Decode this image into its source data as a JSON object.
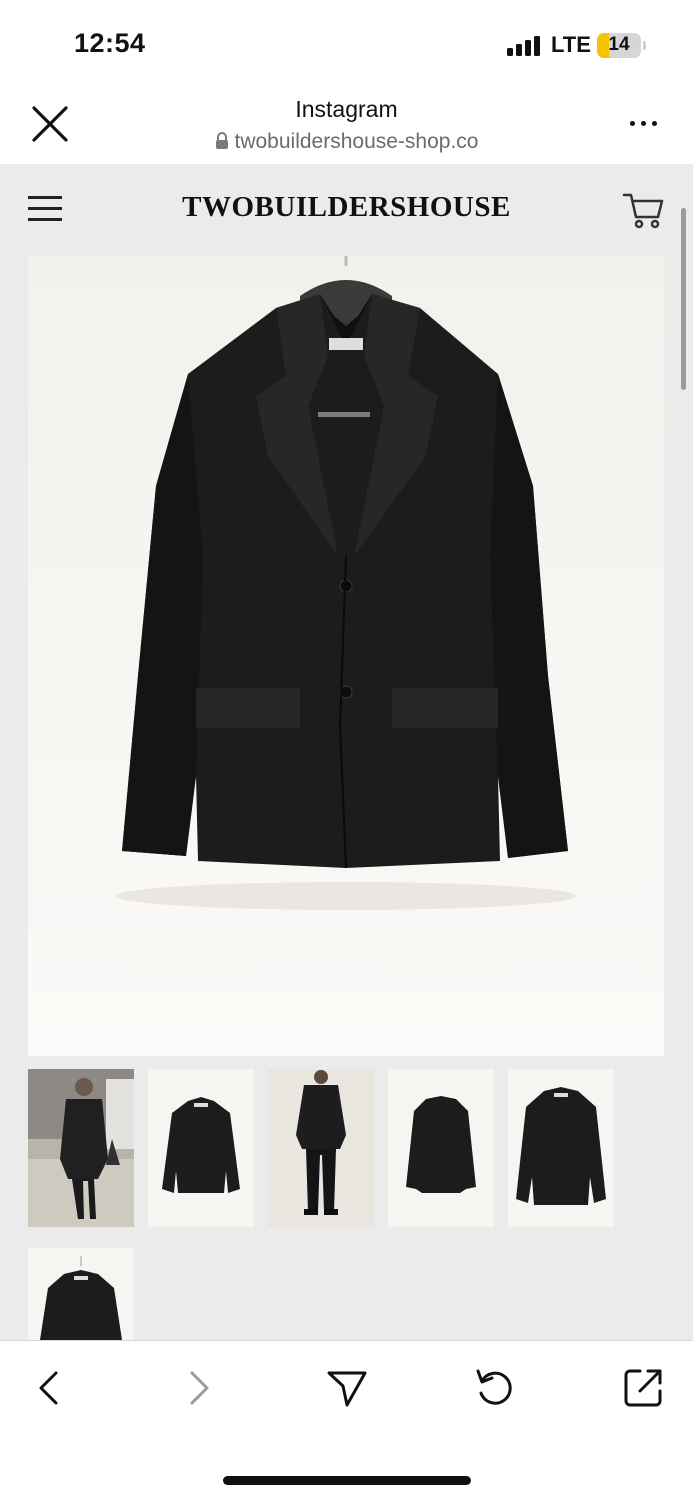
{
  "status_bar": {
    "time": "12:54",
    "network": "LTE",
    "battery_level": "14",
    "battery_color": "#f5c400"
  },
  "browser": {
    "title": "Instagram",
    "url": "twobuildershouse-shop.co",
    "close_icon": "close-icon",
    "lock_icon": "lock-icon",
    "more_icon": "more-horizontal-icon"
  },
  "site": {
    "logo": "TWOBUILDERSHOUSE",
    "menu_icon": "hamburger-menu-icon",
    "cart_icon": "cart-icon",
    "background": "#ebebeb"
  },
  "product": {
    "main_image": "black-jacket-on-hanger",
    "thumbnails": [
      "model-wearing-jacket-outdoor",
      "jacket-front-on-hanger",
      "model-full-body-front",
      "jacket-back-on-hanger",
      "jacket-front-on-hanger-alt",
      "jacket-front-on-hanger-small"
    ]
  },
  "toolbar": {
    "buttons": [
      "back-icon",
      "forward-icon",
      "share-send-icon",
      "reload-icon",
      "open-external-icon"
    ]
  }
}
